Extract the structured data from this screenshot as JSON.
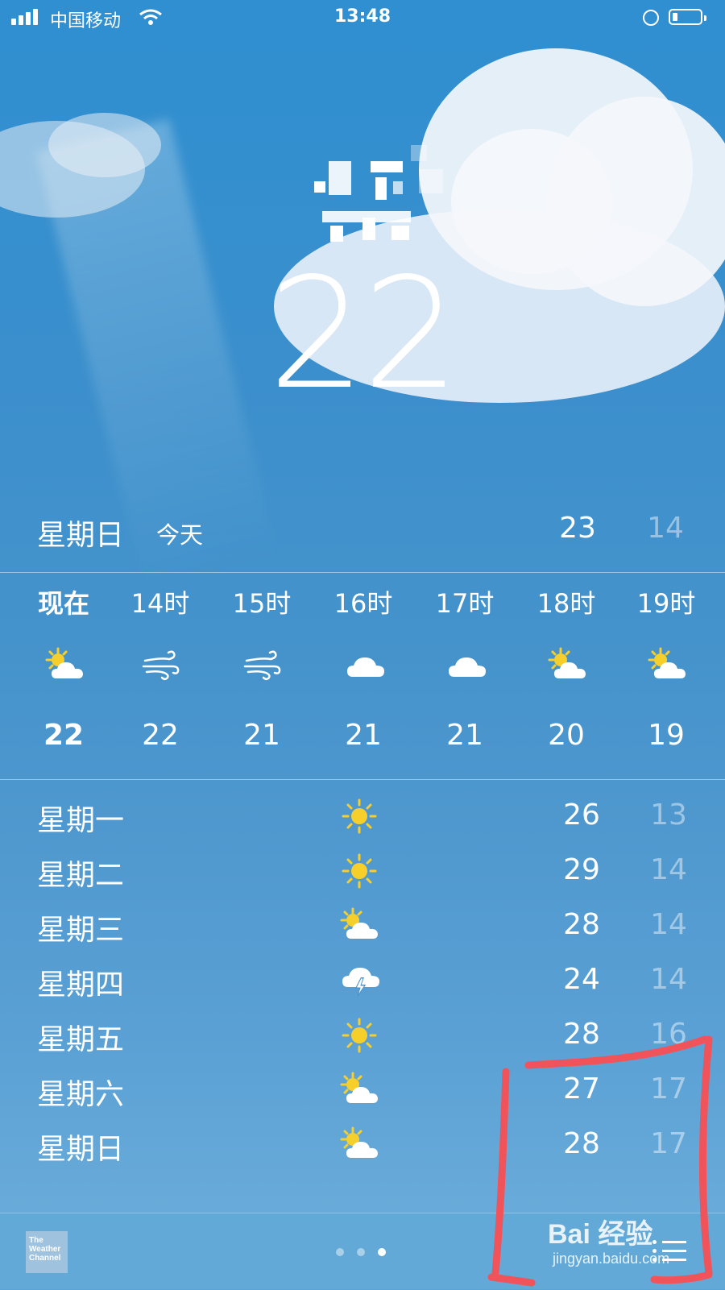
{
  "status_bar": {
    "carrier": "中国移动",
    "time": "13:48",
    "battery_level": 0.15
  },
  "current": {
    "temperature": "22"
  },
  "today": {
    "day": "星期日",
    "label": "今天",
    "high": "23",
    "low": "14"
  },
  "hourly": [
    {
      "label": "现在",
      "icon": "sun-cloud-icon",
      "temp": "22",
      "bold": true
    },
    {
      "label": "14时",
      "icon": "wind-icon",
      "temp": "22"
    },
    {
      "label": "15时",
      "icon": "wind-icon",
      "temp": "21"
    },
    {
      "label": "16时",
      "icon": "cloud-icon",
      "temp": "21"
    },
    {
      "label": "17时",
      "icon": "cloud-icon",
      "temp": "21"
    },
    {
      "label": "18时",
      "icon": "sun-cloud-icon",
      "temp": "20"
    },
    {
      "label": "19时",
      "icon": "sun-cloud-icon",
      "temp": "19"
    }
  ],
  "daily": [
    {
      "day": "星期一",
      "icon": "sun-icon",
      "high": "26",
      "low": "13"
    },
    {
      "day": "星期二",
      "icon": "sun-icon",
      "high": "29",
      "low": "14"
    },
    {
      "day": "星期三",
      "icon": "sun-cloud-icon",
      "high": "28",
      "low": "14"
    },
    {
      "day": "星期四",
      "icon": "thunder-cloud-icon",
      "high": "24",
      "low": "14"
    },
    {
      "day": "星期五",
      "icon": "sun-icon",
      "high": "28",
      "low": "16"
    },
    {
      "day": "星期六",
      "icon": "sun-cloud-icon",
      "high": "27",
      "low": "17"
    },
    {
      "day": "星期日",
      "icon": "sun-cloud-icon",
      "high": "28",
      "low": "17"
    }
  ],
  "bottom_bar": {
    "logo_lines": [
      "The",
      "Weather",
      "Channel"
    ],
    "page_count": 3,
    "active_page": 3
  },
  "watermark": {
    "brand": "Bai 经验",
    "url": "jingyan.baidu.com"
  },
  "colors": {
    "annotation": "#f0545a",
    "sun": "#f7cf2b",
    "background_top": "#2f8fd0"
  }
}
